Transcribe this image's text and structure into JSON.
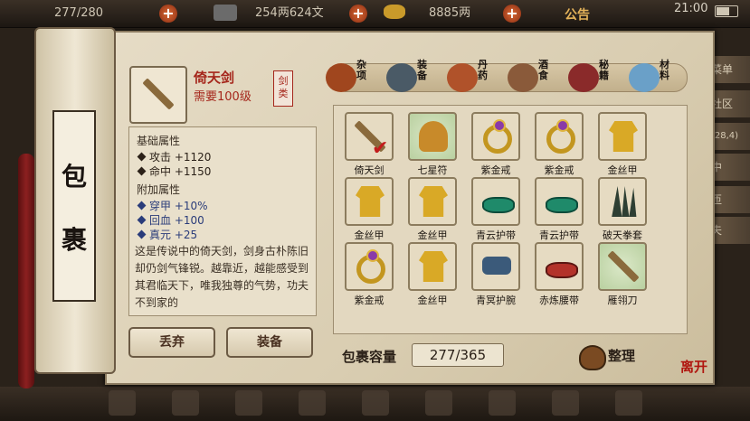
{
  "topbar": {
    "capacity_text": "277/280",
    "money_text": "254两624文",
    "gold_text": "8885两",
    "notice_label": "公告",
    "clock": "21:00"
  },
  "side_menu": [
    "菜单",
    "社区",
    "(28,4)",
    "中",
    "匝",
    "夫"
  ],
  "scroll": {
    "title_chars": [
      "包",
      "裹"
    ]
  },
  "item": {
    "name": "倚天剑",
    "requirement": "需要100级",
    "category_tag": "剑类"
  },
  "base_attrs": {
    "title": "基础属性",
    "items": [
      "攻击 +1120",
      "命中 +1150"
    ]
  },
  "extra_attrs": {
    "title": "附加属性",
    "items": [
      "穿甲 +10%",
      "回血 +100",
      "真元 +25"
    ]
  },
  "description": "这是传说中的倚天剑，剑身古朴陈旧却仍剑气锋锐。越靠近，越能感受到其君临天下，唯我独尊的气势，功夫不到家的",
  "buttons": {
    "discard": "丢弃",
    "equip": "装备",
    "sort": "整理"
  },
  "categories": [
    {
      "label": "杂项",
      "icon": "jar-icon",
      "color": "#a0461e"
    },
    {
      "label": "装备",
      "icon": "armor-icon",
      "color": "#4a5a66"
    },
    {
      "label": "丹药",
      "icon": "pill-icon",
      "color": "#b0522a"
    },
    {
      "label": "酒食",
      "icon": "wine-icon",
      "color": "#8a5a3a"
    },
    {
      "label": "秘籍",
      "icon": "book-icon",
      "color": "#8a2a2a"
    },
    {
      "label": "材料",
      "icon": "crystal-icon",
      "color": "#6aa0c8"
    }
  ],
  "inventory": [
    {
      "name": "倚天剑",
      "kind": "sword",
      "selected": true
    },
    {
      "name": "七星符",
      "kind": "talisman",
      "selected": false
    },
    {
      "name": "紫金戒",
      "kind": "ring",
      "selected": false
    },
    {
      "name": "紫金戒",
      "kind": "ring",
      "selected": false
    },
    {
      "name": "金丝甲",
      "kind": "armor",
      "selected": false
    },
    {
      "name": "金丝甲",
      "kind": "armor",
      "selected": false
    },
    {
      "name": "金丝甲",
      "kind": "armor",
      "selected": false
    },
    {
      "name": "青云护带",
      "kind": "belt",
      "selected": false
    },
    {
      "name": "青云护带",
      "kind": "belt",
      "selected": false
    },
    {
      "name": "破天拳套",
      "kind": "claw",
      "selected": false
    },
    {
      "name": "紫金戒",
      "kind": "ring",
      "selected": false
    },
    {
      "name": "金丝甲",
      "kind": "armor",
      "selected": false
    },
    {
      "name": "青冥护腕",
      "kind": "bracer",
      "selected": false
    },
    {
      "name": "赤炼腰带",
      "kind": "belt-red",
      "selected": false
    },
    {
      "name": "雁翎刀",
      "kind": "sword",
      "selected": false
    }
  ],
  "capacity": {
    "label": "包裹容量",
    "value": "277/365"
  },
  "leave_label": "离开"
}
